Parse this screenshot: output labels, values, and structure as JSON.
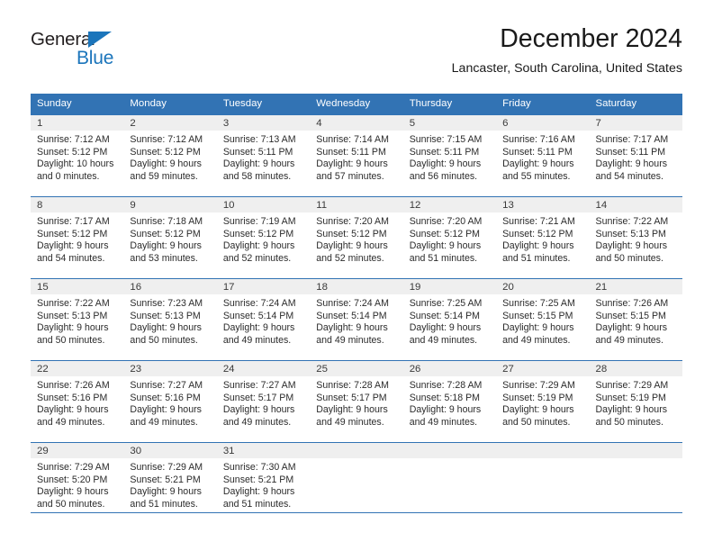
{
  "brand": {
    "name_top": "General",
    "name_bottom": "Blue",
    "triangle_icon": "blue-triangle-logo-mark",
    "accent_color": "#1b75bb"
  },
  "header": {
    "title": "December 2024",
    "subtitle": "Lancaster, South Carolina, United States"
  },
  "calendar": {
    "header_color": "#3273b4",
    "daynum_band_color": "#efefef",
    "weekday_headers": [
      "Sunday",
      "Monday",
      "Tuesday",
      "Wednesday",
      "Thursday",
      "Friday",
      "Saturday"
    ],
    "weeks": [
      [
        {
          "day": "1",
          "sunrise": "Sunrise: 7:12 AM",
          "sunset": "Sunset: 5:12 PM",
          "daylight_line1": "Daylight: 10 hours",
          "daylight_line2": "and 0 minutes."
        },
        {
          "day": "2",
          "sunrise": "Sunrise: 7:12 AM",
          "sunset": "Sunset: 5:12 PM",
          "daylight_line1": "Daylight: 9 hours",
          "daylight_line2": "and 59 minutes."
        },
        {
          "day": "3",
          "sunrise": "Sunrise: 7:13 AM",
          "sunset": "Sunset: 5:11 PM",
          "daylight_line1": "Daylight: 9 hours",
          "daylight_line2": "and 58 minutes."
        },
        {
          "day": "4",
          "sunrise": "Sunrise: 7:14 AM",
          "sunset": "Sunset: 5:11 PM",
          "daylight_line1": "Daylight: 9 hours",
          "daylight_line2": "and 57 minutes."
        },
        {
          "day": "5",
          "sunrise": "Sunrise: 7:15 AM",
          "sunset": "Sunset: 5:11 PM",
          "daylight_line1": "Daylight: 9 hours",
          "daylight_line2": "and 56 minutes."
        },
        {
          "day": "6",
          "sunrise": "Sunrise: 7:16 AM",
          "sunset": "Sunset: 5:11 PM",
          "daylight_line1": "Daylight: 9 hours",
          "daylight_line2": "and 55 minutes."
        },
        {
          "day": "7",
          "sunrise": "Sunrise: 7:17 AM",
          "sunset": "Sunset: 5:11 PM",
          "daylight_line1": "Daylight: 9 hours",
          "daylight_line2": "and 54 minutes."
        }
      ],
      [
        {
          "day": "8",
          "sunrise": "Sunrise: 7:17 AM",
          "sunset": "Sunset: 5:12 PM",
          "daylight_line1": "Daylight: 9 hours",
          "daylight_line2": "and 54 minutes."
        },
        {
          "day": "9",
          "sunrise": "Sunrise: 7:18 AM",
          "sunset": "Sunset: 5:12 PM",
          "daylight_line1": "Daylight: 9 hours",
          "daylight_line2": "and 53 minutes."
        },
        {
          "day": "10",
          "sunrise": "Sunrise: 7:19 AM",
          "sunset": "Sunset: 5:12 PM",
          "daylight_line1": "Daylight: 9 hours",
          "daylight_line2": "and 52 minutes."
        },
        {
          "day": "11",
          "sunrise": "Sunrise: 7:20 AM",
          "sunset": "Sunset: 5:12 PM",
          "daylight_line1": "Daylight: 9 hours",
          "daylight_line2": "and 52 minutes."
        },
        {
          "day": "12",
          "sunrise": "Sunrise: 7:20 AM",
          "sunset": "Sunset: 5:12 PM",
          "daylight_line1": "Daylight: 9 hours",
          "daylight_line2": "and 51 minutes."
        },
        {
          "day": "13",
          "sunrise": "Sunrise: 7:21 AM",
          "sunset": "Sunset: 5:12 PM",
          "daylight_line1": "Daylight: 9 hours",
          "daylight_line2": "and 51 minutes."
        },
        {
          "day": "14",
          "sunrise": "Sunrise: 7:22 AM",
          "sunset": "Sunset: 5:13 PM",
          "daylight_line1": "Daylight: 9 hours",
          "daylight_line2": "and 50 minutes."
        }
      ],
      [
        {
          "day": "15",
          "sunrise": "Sunrise: 7:22 AM",
          "sunset": "Sunset: 5:13 PM",
          "daylight_line1": "Daylight: 9 hours",
          "daylight_line2": "and 50 minutes."
        },
        {
          "day": "16",
          "sunrise": "Sunrise: 7:23 AM",
          "sunset": "Sunset: 5:13 PM",
          "daylight_line1": "Daylight: 9 hours",
          "daylight_line2": "and 50 minutes."
        },
        {
          "day": "17",
          "sunrise": "Sunrise: 7:24 AM",
          "sunset": "Sunset: 5:14 PM",
          "daylight_line1": "Daylight: 9 hours",
          "daylight_line2": "and 49 minutes."
        },
        {
          "day": "18",
          "sunrise": "Sunrise: 7:24 AM",
          "sunset": "Sunset: 5:14 PM",
          "daylight_line1": "Daylight: 9 hours",
          "daylight_line2": "and 49 minutes."
        },
        {
          "day": "19",
          "sunrise": "Sunrise: 7:25 AM",
          "sunset": "Sunset: 5:14 PM",
          "daylight_line1": "Daylight: 9 hours",
          "daylight_line2": "and 49 minutes."
        },
        {
          "day": "20",
          "sunrise": "Sunrise: 7:25 AM",
          "sunset": "Sunset: 5:15 PM",
          "daylight_line1": "Daylight: 9 hours",
          "daylight_line2": "and 49 minutes."
        },
        {
          "day": "21",
          "sunrise": "Sunrise: 7:26 AM",
          "sunset": "Sunset: 5:15 PM",
          "daylight_line1": "Daylight: 9 hours",
          "daylight_line2": "and 49 minutes."
        }
      ],
      [
        {
          "day": "22",
          "sunrise": "Sunrise: 7:26 AM",
          "sunset": "Sunset: 5:16 PM",
          "daylight_line1": "Daylight: 9 hours",
          "daylight_line2": "and 49 minutes."
        },
        {
          "day": "23",
          "sunrise": "Sunrise: 7:27 AM",
          "sunset": "Sunset: 5:16 PM",
          "daylight_line1": "Daylight: 9 hours",
          "daylight_line2": "and 49 minutes."
        },
        {
          "day": "24",
          "sunrise": "Sunrise: 7:27 AM",
          "sunset": "Sunset: 5:17 PM",
          "daylight_line1": "Daylight: 9 hours",
          "daylight_line2": "and 49 minutes."
        },
        {
          "day": "25",
          "sunrise": "Sunrise: 7:28 AM",
          "sunset": "Sunset: 5:17 PM",
          "daylight_line1": "Daylight: 9 hours",
          "daylight_line2": "and 49 minutes."
        },
        {
          "day": "26",
          "sunrise": "Sunrise: 7:28 AM",
          "sunset": "Sunset: 5:18 PM",
          "daylight_line1": "Daylight: 9 hours",
          "daylight_line2": "and 49 minutes."
        },
        {
          "day": "27",
          "sunrise": "Sunrise: 7:29 AM",
          "sunset": "Sunset: 5:19 PM",
          "daylight_line1": "Daylight: 9 hours",
          "daylight_line2": "and 50 minutes."
        },
        {
          "day": "28",
          "sunrise": "Sunrise: 7:29 AM",
          "sunset": "Sunset: 5:19 PM",
          "daylight_line1": "Daylight: 9 hours",
          "daylight_line2": "and 50 minutes."
        }
      ],
      [
        {
          "day": "29",
          "sunrise": "Sunrise: 7:29 AM",
          "sunset": "Sunset: 5:20 PM",
          "daylight_line1": "Daylight: 9 hours",
          "daylight_line2": "and 50 minutes."
        },
        {
          "day": "30",
          "sunrise": "Sunrise: 7:29 AM",
          "sunset": "Sunset: 5:21 PM",
          "daylight_line1": "Daylight: 9 hours",
          "daylight_line2": "and 51 minutes."
        },
        {
          "day": "31",
          "sunrise": "Sunrise: 7:30 AM",
          "sunset": "Sunset: 5:21 PM",
          "daylight_line1": "Daylight: 9 hours",
          "daylight_line2": "and 51 minutes."
        },
        {
          "day": "",
          "sunrise": "",
          "sunset": "",
          "daylight_line1": "",
          "daylight_line2": ""
        },
        {
          "day": "",
          "sunrise": "",
          "sunset": "",
          "daylight_line1": "",
          "daylight_line2": ""
        },
        {
          "day": "",
          "sunrise": "",
          "sunset": "",
          "daylight_line1": "",
          "daylight_line2": ""
        },
        {
          "day": "",
          "sunrise": "",
          "sunset": "",
          "daylight_line1": "",
          "daylight_line2": ""
        }
      ]
    ]
  }
}
